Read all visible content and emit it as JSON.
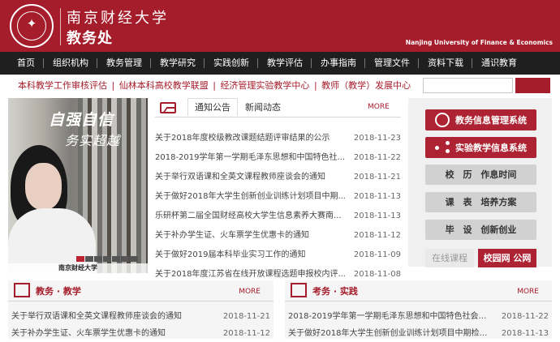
{
  "header": {
    "school_name": "南京财经大学",
    "department": "教务处",
    "english_name": "Nanjing University of Finance & Economics",
    "brand_color": "#a51c2a"
  },
  "nav": [
    "首页",
    "组织机构",
    "教务管理",
    "教学研究",
    "实践创新",
    "教学评估",
    "办事指南",
    "管理文件",
    "资料下载",
    "通识教育"
  ],
  "quicklinks": [
    "本科教学工作审核评估",
    "仙林本科高校教学联盟",
    "经济管理实验教学中心",
    "教师（教学）发展中心"
  ],
  "quicklink_separator": "|",
  "search": {
    "placeholder": ""
  },
  "hero": {
    "title_line_1": "自强自信",
    "title_line_2": "务实超越",
    "caption": "南京财经大学",
    "indicators": [
      "1",
      "2",
      "3",
      "4",
      "5",
      "6",
      "7"
    ]
  },
  "notices": {
    "tabs": [
      "通知公告",
      "新闻动态"
    ],
    "more": "MORE",
    "items": [
      {
        "title": "关于2018年度校级教改课题结题评审结果的公示",
        "date": "2018-11-23"
      },
      {
        "title": "2018-2019学年第一学期毛泽东思想和中国特色社...",
        "date": "2018-11-22"
      },
      {
        "title": "关于举行双语课和全英文课程教师座谈会的通知",
        "date": "2018-11-21"
      },
      {
        "title": "关于做好2018年大学生创新创业训练计划项目中期...",
        "date": "2018-11-13"
      },
      {
        "title": "乐研杯第二届全国财经高校大学生信息素养大赛南...",
        "date": "2018-11-13"
      },
      {
        "title": "关于补办学生证、火车票学生优惠卡的通知",
        "date": "2018-11-12"
      },
      {
        "title": "关于做好2019届本科毕业实习工作的通知",
        "date": "2018-11-09"
      },
      {
        "title": "关于2018年度江苏省在线开放课程选题申报校内评...",
        "date": "2018-11-08"
      }
    ]
  },
  "side": {
    "buttons": [
      "教务信息管理系统",
      "实验教学信息系统"
    ],
    "gray_buttons": [
      "校 历    作息时间",
      "课 表    培养方案",
      "毕 设    创新创业"
    ],
    "online_course": "在线课程",
    "campus_public": "校园网 公网"
  },
  "sections": [
    {
      "title": "教务 · 教学",
      "more": "MORE",
      "items": [
        {
          "title": "关于举行双语课和全英文课程教师座谈会的通知",
          "date": "2018-11-21"
        },
        {
          "title": "关于补办学生证、火车票学生优惠卡的通知",
          "date": "2018-11-12"
        }
      ]
    },
    {
      "title": "考务 · 实践",
      "more": "MORE",
      "items": [
        {
          "title": "2018-2019学年第一学期毛泽东思想和中国特色社会主...",
          "date": "2018-11-22"
        },
        {
          "title": "关于做好2018年大学生创新创业训练计划项目中期检查...",
          "date": "2018-11-13"
        }
      ]
    }
  ]
}
